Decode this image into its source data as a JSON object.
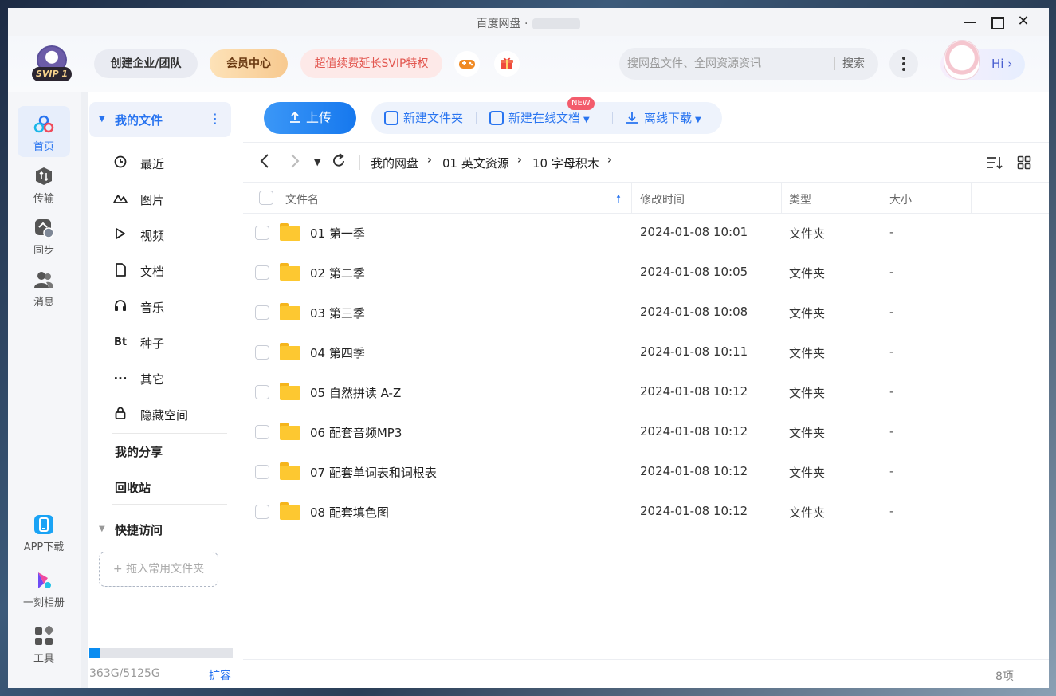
{
  "window": {
    "title": "百度网盘 ·"
  },
  "header": {
    "svip_badge": "SVIP 1",
    "team_button": "创建企业/团队",
    "vip_center_button": "会员中心",
    "renew_button": "超值续费延长SVIP特权",
    "search": {
      "placeholder": "搜网盘文件、全网资源资讯",
      "button": "搜索"
    },
    "hi_label": "Hi ›",
    "game_icon": "gamepad-icon",
    "gift_icon": "gift-icon"
  },
  "leftnav": {
    "items": [
      {
        "label": "首页",
        "icon": "home-icon",
        "active": true
      },
      {
        "label": "传输",
        "icon": "transfer-icon"
      },
      {
        "label": "同步",
        "icon": "sync-icon"
      },
      {
        "label": "消息",
        "icon": "message-icon"
      }
    ],
    "bottom": [
      {
        "label": "APP下载",
        "icon": "phone-icon"
      },
      {
        "label": "一刻相册",
        "icon": "album-icon"
      },
      {
        "label": "工具",
        "icon": "tools-icon"
      }
    ]
  },
  "side": {
    "my_files": "我的文件",
    "items": [
      {
        "label": "最近",
        "icon": "clock-icon"
      },
      {
        "label": "图片",
        "icon": "image-icon"
      },
      {
        "label": "视频",
        "icon": "play-icon"
      },
      {
        "label": "文档",
        "icon": "doc-icon"
      },
      {
        "label": "音乐",
        "icon": "headphone-icon"
      },
      {
        "label": "种子",
        "icon": "bt-icon"
      },
      {
        "label": "其它",
        "icon": "more-icon"
      },
      {
        "label": "隐藏空间",
        "icon": "lock-icon"
      }
    ],
    "my_share": "我的分享",
    "recycle": "回收站",
    "quick_access": "快捷访问",
    "drop_hint": "+ 拖入常用文件夹",
    "storage": {
      "text": "363G/5125G",
      "used_fraction": 0.071
    },
    "expand": "扩容"
  },
  "toolbar": {
    "upload": "上传",
    "new_folder": "新建文件夹",
    "new_doc": "新建在线文档",
    "new_badge": "NEW",
    "offline_download": "离线下载"
  },
  "breadcrumb": [
    "我的网盘",
    "01 英文资源",
    "10 字母积木"
  ],
  "table": {
    "headers": {
      "name": "文件名",
      "modified": "修改时间",
      "type": "类型",
      "size": "大小"
    },
    "rows": [
      {
        "name": "01 第一季",
        "modified": "2024-01-08 10:01",
        "type": "文件夹",
        "size": "-"
      },
      {
        "name": "02 第二季",
        "modified": "2024-01-08 10:05",
        "type": "文件夹",
        "size": "-"
      },
      {
        "name": "03 第三季",
        "modified": "2024-01-08 10:08",
        "type": "文件夹",
        "size": "-"
      },
      {
        "name": "04 第四季",
        "modified": "2024-01-08 10:11",
        "type": "文件夹",
        "size": "-"
      },
      {
        "name": "05 自然拼读 A-Z",
        "modified": "2024-01-08 10:12",
        "type": "文件夹",
        "size": "-"
      },
      {
        "name": "06 配套音频MP3",
        "modified": "2024-01-08 10:12",
        "type": "文件夹",
        "size": "-"
      },
      {
        "name": "07 配套单词表和词根表",
        "modified": "2024-01-08 10:12",
        "type": "文件夹",
        "size": "-"
      },
      {
        "name": "08 配套填色图",
        "modified": "2024-01-08 10:12",
        "type": "文件夹",
        "size": "-"
      }
    ]
  },
  "footer": {
    "count": "8项"
  },
  "colors": {
    "accent": "#2874f0",
    "folder": "#fdc831",
    "renew": "#e2564f"
  }
}
